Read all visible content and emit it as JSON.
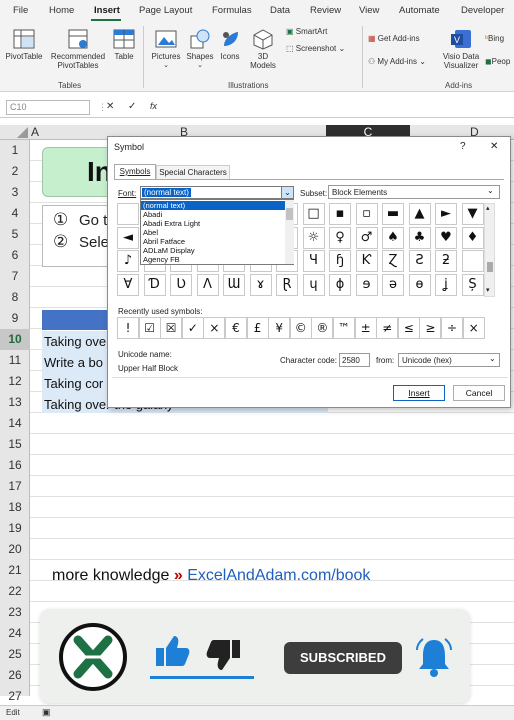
{
  "menu": {
    "tabs": [
      "File",
      "Home",
      "Insert",
      "Page Layout",
      "Formulas",
      "Data",
      "Review",
      "View",
      "Automate",
      "Developer"
    ]
  },
  "ribbon": {
    "pivottable": "PivotTable",
    "recommended": "Recommended",
    "pivottables": "PivotTables",
    "table": "Table",
    "pictures": "Pictures",
    "shapes": "Shapes",
    "icons": "Icons",
    "models_3d": "3D",
    "models": "Models",
    "smartart": "SmartArt",
    "screenshot": "Screenshot",
    "get_addins": "Get Add-ins",
    "my_addins": "My Add-ins",
    "visio1": "Visio Data",
    "visio2": "Visualizer",
    "bing": "Bing",
    "people": "Peop",
    "groups": {
      "tables": "Tables",
      "illustrations": "Illustrations",
      "addins": "Add-ins"
    }
  },
  "formula_bar": {
    "name_box": "C10",
    "cancel": "✕",
    "enter": "✓",
    "fx": "fx"
  },
  "grid": {
    "columns": [
      "A",
      "B",
      "C",
      "D"
    ],
    "rows": [
      "1",
      "2",
      "3",
      "4",
      "5",
      "6",
      "7",
      "8",
      "9",
      "10",
      "11",
      "12",
      "13",
      "14",
      "15",
      "16",
      "17",
      "18",
      "19",
      "20",
      "21",
      "22",
      "23",
      "24",
      "25",
      "26",
      "27"
    ],
    "selected_row": "10",
    "title_partial": "In",
    "step1_num": "①",
    "step1": "Go t",
    "step2_num": "②",
    "step2": "Sele",
    "list": [
      "Taking ove",
      "Write a bo",
      "Taking cor",
      "Taking over the galaxy"
    ]
  },
  "promo": {
    "text": "more knowledge",
    "arrow": "»",
    "link": "ExcelAndAdam.com/book",
    "subscribe": "SUBSCRIBED"
  },
  "status": {
    "mode": "Edit"
  },
  "dialog": {
    "title": "Symbol",
    "help": "?",
    "close": "✕",
    "tabs": [
      "Symbols",
      "Special Characters"
    ],
    "font_label": "Font:",
    "font_value": "(normal text)",
    "subset_label": "Subset:",
    "subset_value": "Block Elements",
    "font_list": [
      "(normal text)",
      "Abadi",
      "Abadi Extra Light",
      "Abel",
      "Abril Fatface",
      "ADLaM Display",
      "Agency FB"
    ],
    "grid_rows": [
      [
        "",
        "",
        "",
        "",
        "",
        "▒",
        "■",
        "□",
        "▪",
        "▫",
        "▬",
        "▲",
        "►",
        "▼"
      ],
      [
        "◄",
        "",
        "",
        "",
        "",
        "○",
        "☻",
        "☼",
        "♀",
        "♂",
        "♠",
        "♣",
        "♥",
        "♦"
      ],
      [
        "♪",
        "",
        "",
        "",
        "",
        "ȼ",
        "ɗ",
        "Ɥ",
        "ɧ",
        "Ƙ",
        "Ɀ",
        "Ƨ",
        "ƻ",
        ""
      ],
      [
        "Ɐ",
        "Ɗ",
        "Ʋ",
        "Ʌ",
        "Ɯ",
        "ɤ",
        "Ɽ",
        "ɥ",
        "ɸ",
        "ɘ",
        "ə",
        "ɵ",
        "ʝ",
        "Ș"
      ]
    ],
    "recent_label": "Recently used symbols:",
    "recent": [
      "!",
      "☑",
      "☒",
      "✓",
      "×",
      "€",
      "£",
      "¥",
      "©",
      "®",
      "™",
      "±",
      "≠",
      "≤",
      "≥",
      "÷",
      "×"
    ],
    "unicode_name_label": "Unicode name:",
    "unicode_name": "Upper Half Block",
    "char_code_label": "Character code:",
    "char_code": "2580",
    "from_label": "from:",
    "from_value": "Unicode (hex)",
    "insert": "Insert",
    "cancel": "Cancel"
  },
  "colors": {
    "excel_green": "#1e7145",
    "title_fill": "#c6efce",
    "list_fill": "#dce9f7",
    "header_fill": "#4472c4",
    "link_blue": "#1f5fbf",
    "arrow_red": "#c00000"
  }
}
